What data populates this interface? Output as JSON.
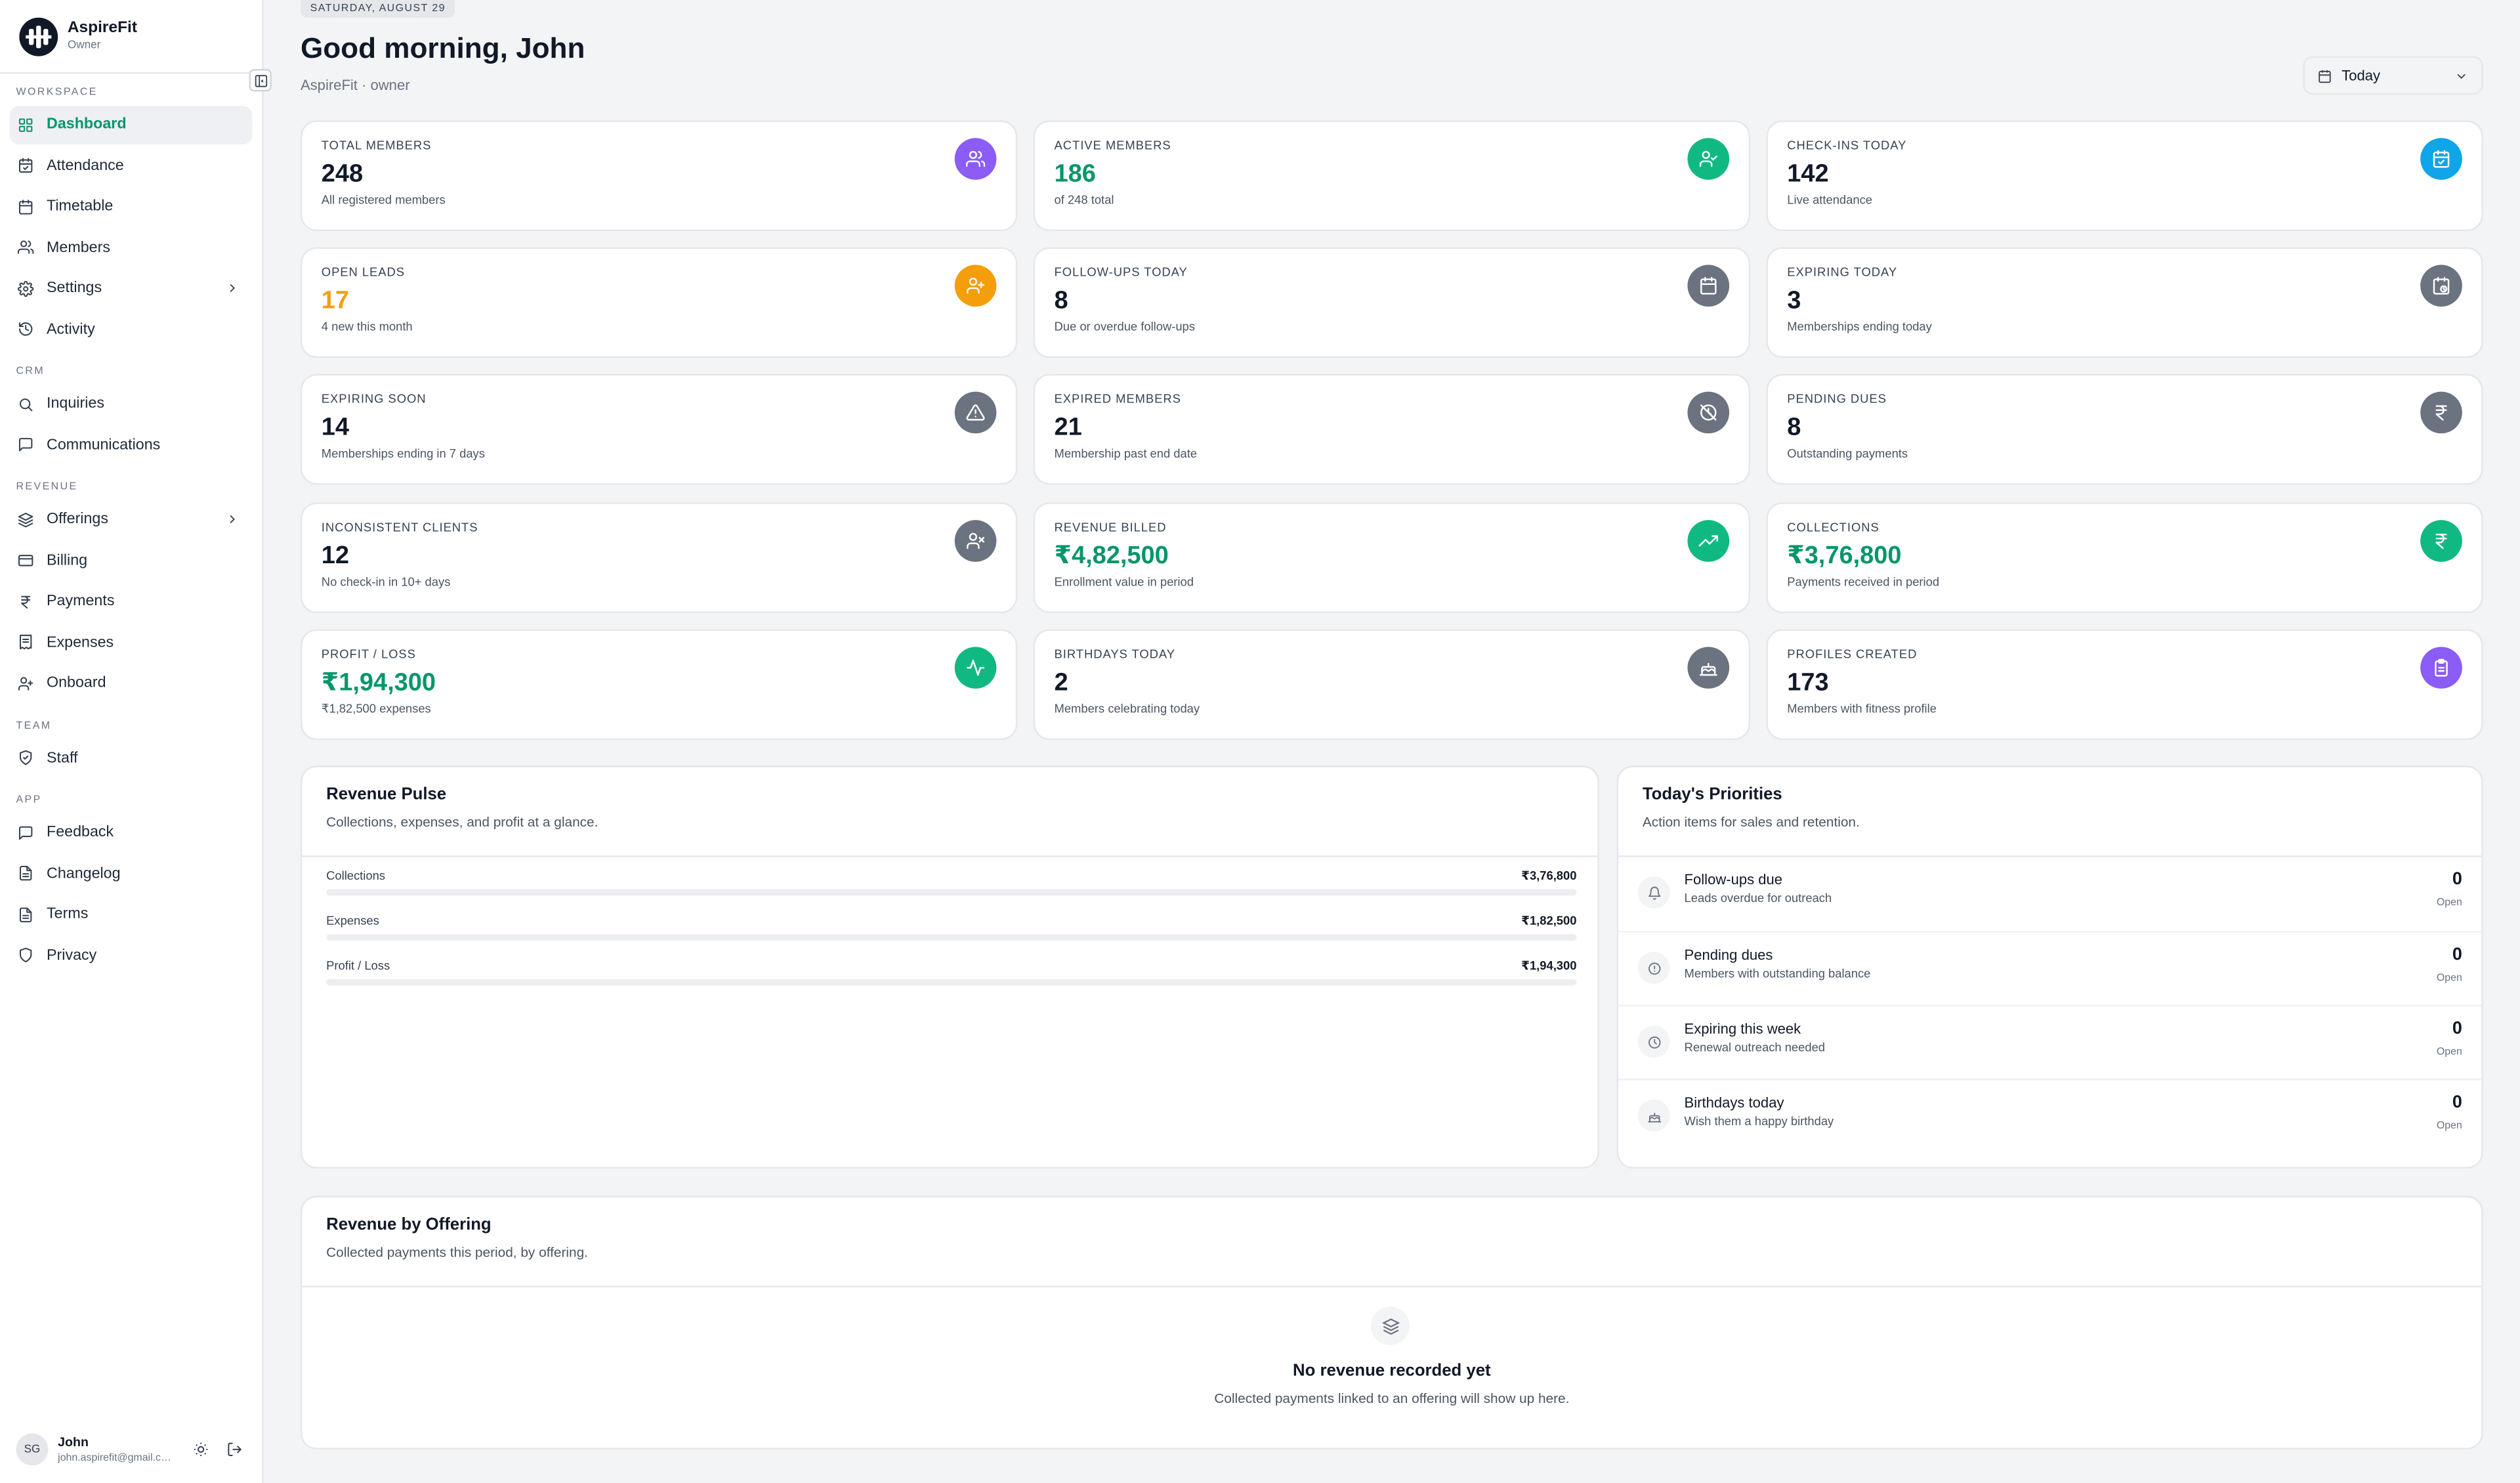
{
  "brand": {
    "name": "AspireFit",
    "role": "Owner"
  },
  "sidebar": {
    "sections": [
      {
        "title": "WORKSPACE",
        "items": [
          {
            "label": "Dashboard",
            "icon": "grid-icon",
            "active": true
          },
          {
            "label": "Attendance",
            "icon": "calendar-check-icon"
          },
          {
            "label": "Timetable",
            "icon": "calendar-icon"
          },
          {
            "label": "Members",
            "icon": "users-icon"
          },
          {
            "label": "Settings",
            "icon": "gear-icon",
            "expandable": true
          },
          {
            "label": "Activity",
            "icon": "history-icon"
          }
        ]
      },
      {
        "title": "CRM",
        "items": [
          {
            "label": "Inquiries",
            "icon": "search-icon"
          },
          {
            "label": "Communications",
            "icon": "message-icon"
          }
        ]
      },
      {
        "title": "REVENUE",
        "items": [
          {
            "label": "Offerings",
            "icon": "layers-icon",
            "expandable": true
          },
          {
            "label": "Billing",
            "icon": "wallet-icon"
          },
          {
            "label": "Payments",
            "icon": "rupee-icon"
          },
          {
            "label": "Expenses",
            "icon": "receipt-icon"
          },
          {
            "label": "Onboard",
            "icon": "user-plus-icon"
          }
        ]
      },
      {
        "title": "TEAM",
        "items": [
          {
            "label": "Staff",
            "icon": "shield-check-icon"
          }
        ]
      },
      {
        "title": "APP",
        "items": [
          {
            "label": "Feedback",
            "icon": "message-icon"
          },
          {
            "label": "Changelog",
            "icon": "document-icon"
          },
          {
            "label": "Terms",
            "icon": "document-icon"
          },
          {
            "label": "Privacy",
            "icon": "shield-icon"
          }
        ]
      }
    ]
  },
  "user": {
    "initials": "SG",
    "name": "John",
    "email": "john.aspirefit@gmail.com"
  },
  "header": {
    "date": "SATURDAY, AUGUST 29",
    "greeting": "Good morning, John",
    "subtitle": "AspireFit · owner",
    "period": "Today"
  },
  "colors": {
    "accent": "#059669",
    "orange": "#f59e0b",
    "green": "#10b981",
    "purple": "#8b5cf6",
    "blue": "#0ea5e9",
    "gray": "#6b7280"
  },
  "stats": [
    {
      "label": "TOTAL MEMBERS",
      "value": "248",
      "desc": "All registered members",
      "valueColor": "#111827",
      "iconColor": "#8b5cf6",
      "icon": "users-icon"
    },
    {
      "label": "ACTIVE MEMBERS",
      "value": "186",
      "desc": "of 248 total",
      "valueColor": "#059669",
      "iconColor": "#10b981",
      "icon": "user-check-icon"
    },
    {
      "label": "CHECK-INS TODAY",
      "value": "142",
      "desc": "Live attendance",
      "valueColor": "#111827",
      "iconColor": "#0ea5e9",
      "icon": "calendar-check-icon"
    },
    {
      "label": "OPEN LEADS",
      "value": "17",
      "desc": "4 new this month",
      "valueColor": "#f59e0b",
      "iconColor": "#f59e0b",
      "icon": "user-plus-icon"
    },
    {
      "label": "FOLLOW-UPS TODAY",
      "value": "8",
      "desc": "Due or overdue follow-ups",
      "valueColor": "#111827",
      "iconColor": "#6b7280",
      "icon": "calendar-icon"
    },
    {
      "label": "EXPIRING TODAY",
      "value": "3",
      "desc": "Memberships ending today",
      "valueColor": "#111827",
      "iconColor": "#6b7280",
      "icon": "calendar-clock-icon"
    },
    {
      "label": "EXPIRING SOON",
      "value": "14",
      "desc": "Memberships ending in 7 days",
      "valueColor": "#111827",
      "iconColor": "#6b7280",
      "icon": "warning-icon"
    },
    {
      "label": "EXPIRED MEMBERS",
      "value": "21",
      "desc": "Membership past end date",
      "valueColor": "#111827",
      "iconColor": "#6b7280",
      "icon": "clock-off-icon"
    },
    {
      "label": "PENDING DUES",
      "value": "8",
      "desc": "Outstanding payments",
      "valueColor": "#111827",
      "iconColor": "#6b7280",
      "icon": "rupee-icon"
    },
    {
      "label": "INCONSISTENT CLIENTS",
      "value": "12",
      "desc": "No check-in in 10+ days",
      "valueColor": "#111827",
      "iconColor": "#6b7280",
      "icon": "user-x-icon"
    },
    {
      "label": "REVENUE BILLED",
      "value": "₹4,82,500",
      "desc": "Enrollment value in period",
      "valueColor": "#059669",
      "iconColor": "#10b981",
      "icon": "trending-up-icon"
    },
    {
      "label": "COLLECTIONS",
      "value": "₹3,76,800",
      "desc": "Payments received in period",
      "valueColor": "#059669",
      "iconColor": "#10b981",
      "icon": "rupee-icon"
    },
    {
      "label": "PROFIT / LOSS",
      "value": "₹1,94,300",
      "desc": "₹1,82,500 expenses",
      "valueColor": "#059669",
      "iconColor": "#10b981",
      "icon": "activity-icon"
    },
    {
      "label": "BIRTHDAYS TODAY",
      "value": "2",
      "desc": "Members celebrating today",
      "valueColor": "#111827",
      "iconColor": "#6b7280",
      "icon": "cake-icon"
    },
    {
      "label": "PROFILES CREATED",
      "value": "173",
      "desc": "Members with fitness profile",
      "valueColor": "#111827",
      "iconColor": "#8b5cf6",
      "icon": "clipboard-icon"
    }
  ],
  "pulse": {
    "title": "Revenue Pulse",
    "subtitle": "Collections, expenses, and profit at a glance.",
    "rows": [
      {
        "label": "Collections",
        "amount": "₹3,76,800"
      },
      {
        "label": "Expenses",
        "amount": "₹1,82,500"
      },
      {
        "label": "Profit / Loss",
        "amount": "₹1,94,300"
      }
    ]
  },
  "priorities": {
    "title": "Today's Priorities",
    "subtitle": "Action items for sales and retention.",
    "items": [
      {
        "title": "Follow-ups due",
        "desc": "Leads overdue for outreach",
        "count": "0",
        "status": "Open",
        "icon": "bell-icon"
      },
      {
        "title": "Pending dues",
        "desc": "Members with outstanding balance",
        "count": "0",
        "status": "Open",
        "icon": "alert-circle-icon"
      },
      {
        "title": "Expiring this week",
        "desc": "Renewal outreach needed",
        "count": "0",
        "status": "Open",
        "icon": "clock-icon"
      },
      {
        "title": "Birthdays today",
        "desc": "Wish them a happy birthday",
        "count": "0",
        "status": "Open",
        "icon": "cake-icon"
      }
    ]
  },
  "offering": {
    "title": "Revenue by Offering",
    "subtitle": "Collected payments this period, by offering.",
    "empty_title": "No revenue recorded yet",
    "empty_desc": "Collected payments linked to an offering will show up here."
  }
}
